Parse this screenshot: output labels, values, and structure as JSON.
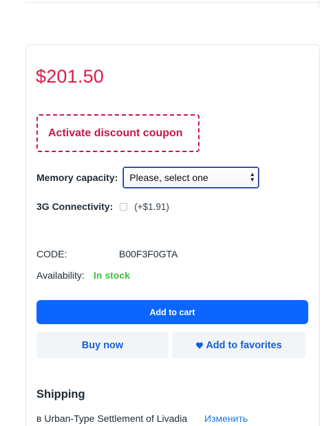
{
  "product": {
    "price": "$201.50",
    "coupon_label": "Activate discount coupon"
  },
  "options": {
    "memory_label": "Memory capacity:",
    "memory_select_value": "Please, select one",
    "connectivity_label": "3G Connectivity:",
    "connectivity_addon": "(+$1.91)",
    "connectivity_checked": false
  },
  "details": {
    "code_label": "CODE:",
    "code_value": "B00F3F0GTA",
    "availability_label": "Availability:",
    "availability_value": "In stock"
  },
  "actions": {
    "add_to_cart": "Add to cart",
    "buy_now": "Buy now",
    "add_to_favorites": "Add to favorites"
  },
  "shipping": {
    "title": "Shipping",
    "location": "в Urban-Type Settlement of Livadia",
    "change_link": "Изменить"
  },
  "colors": {
    "price": "#e3174a",
    "coupon": "#c8164a",
    "primary_button": "#0a66ff",
    "in_stock": "#3fbf3f",
    "link": "#1a73e8"
  },
  "icons": {
    "favorites": "heart-icon",
    "select_arrow": "chevron-up-down-icon"
  }
}
